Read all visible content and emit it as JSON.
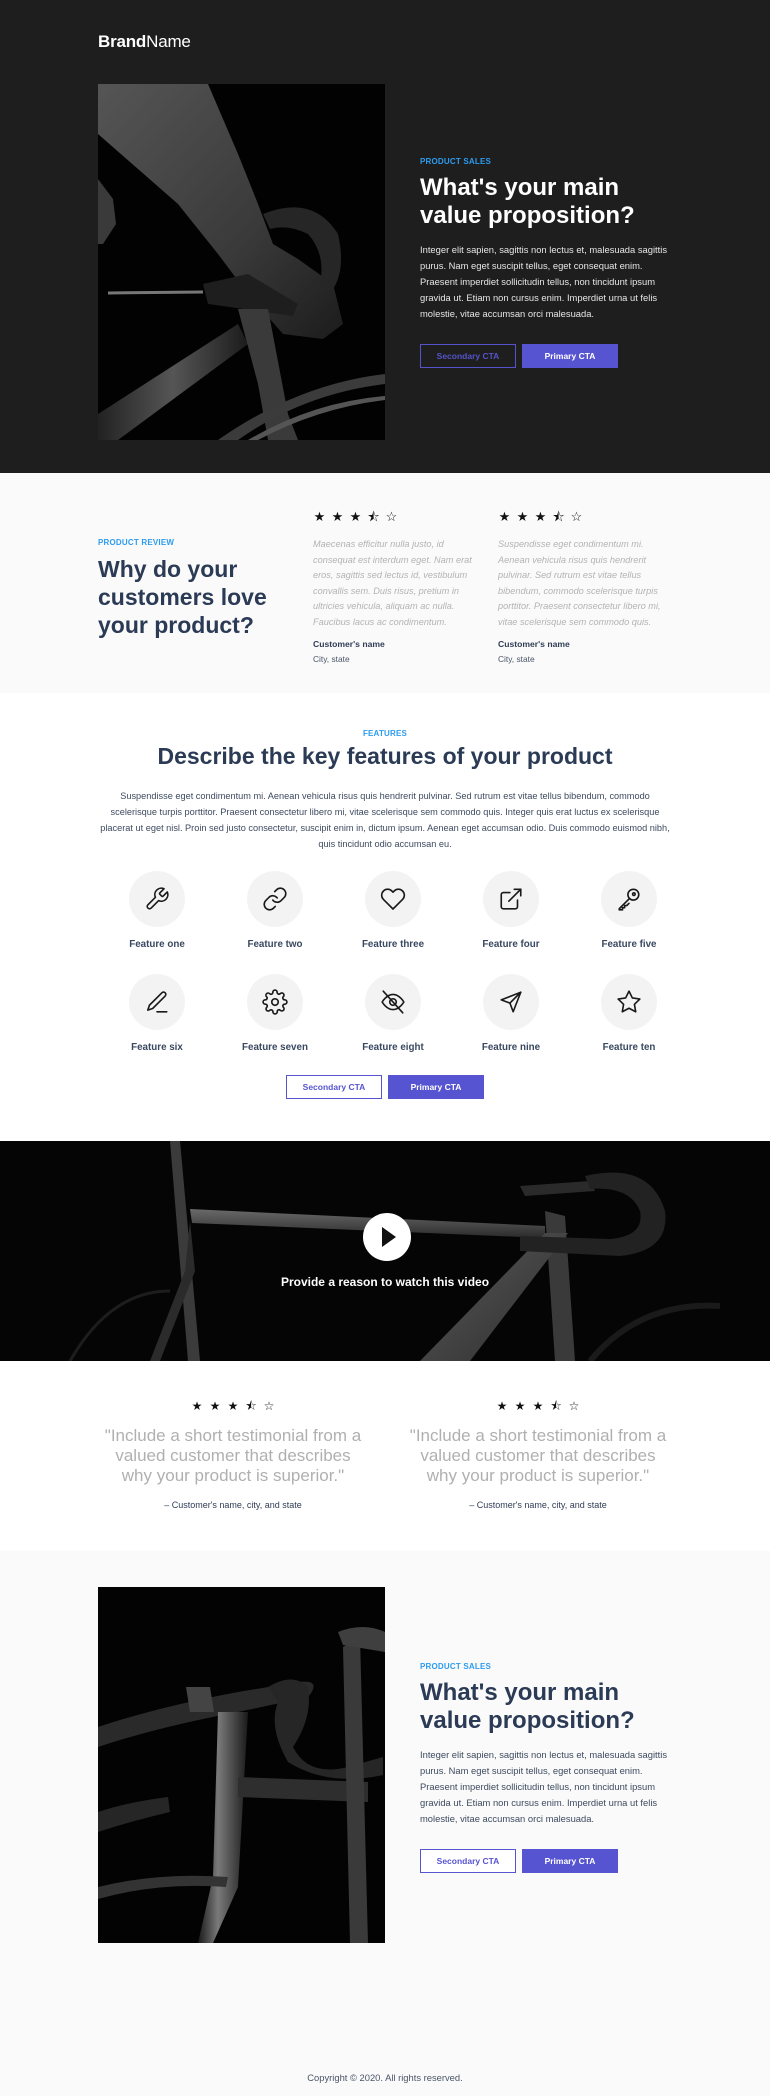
{
  "brand": {
    "bold": "Brand",
    "regular": "Name"
  },
  "hero": {
    "eyebrow": "PRODUCT SALES",
    "title": "What's your main value proposition?",
    "body": "Integer elit sapien, sagittis non lectus et, malesuada sagittis purus. Nam eget suscipit tellus, eget consequat enim. Praesent imperdiet sollicitudin tellus, non tincidunt ipsum gravida ut. Etiam non cursus enim. Imperdiet urna ut felis molestie, vitae accumsan orci malesuada.",
    "secondary_cta": "Secondary CTA",
    "primary_cta": "Primary CTA",
    "image_alt": "cyclist-arm-on-handlebar-photo"
  },
  "review": {
    "eyebrow": "PRODUCT REVIEW",
    "title": "Why do your customers love your product?",
    "cards": [
      {
        "rating": 3.5,
        "stars": [
          "★",
          "★",
          "★",
          "⯪",
          "☆"
        ],
        "text": "Maecenas efficitur nulla justo, id consequat est interdum eget. Nam erat eros, sagittis sed lectus id, vestibulum convallis sem. Duis risus, pretium in ultricies vehicula, aliquam ac nulla. Faucibus lacus ac condimentum.",
        "name": "Customer's name",
        "location": "City, state"
      },
      {
        "rating": 3.5,
        "stars": [
          "★",
          "★",
          "★",
          "⯪",
          "☆"
        ],
        "text": "Suspendisse eget condimentum mi. Aenean vehicula risus quis hendrerit pulvinar. Sed rutrum est vitae tellus bibendum, commodo scelerisque turpis porttitor. Praesent consectetur libero mi, vitae scelerisque sem commodo quis.",
        "name": "Customer's name",
        "location": "City, state"
      }
    ]
  },
  "features": {
    "eyebrow": "FEATURES",
    "title": "Describe the key features of your product",
    "description": "Suspendisse eget condimentum mi. Aenean vehicula risus quis hendrerit pulvinar. Sed rutrum est vitae tellus bibendum, commodo scelerisque turpis porttitor. Praesent consectetur libero mi, vitae scelerisque sem commodo quis. Integer quis erat luctus ex scelerisque placerat ut eget nisl. Proin sed justo consectetur, suscipit enim in, dictum ipsum. Aenean eget accumsan odio. Duis commodo euismod nibh, quis tincidunt odio accumsan eu.",
    "items": [
      {
        "label": "Feature one",
        "icon": "wrench-icon"
      },
      {
        "label": "Feature two",
        "icon": "link-icon"
      },
      {
        "label": "Feature three",
        "icon": "heart-icon"
      },
      {
        "label": "Feature four",
        "icon": "external-link-icon"
      },
      {
        "label": "Feature five",
        "icon": "key-icon"
      },
      {
        "label": "Feature six",
        "icon": "pen-icon"
      },
      {
        "label": "Feature seven",
        "icon": "gear-icon"
      },
      {
        "label": "Feature eight",
        "icon": "eye-off-icon"
      },
      {
        "label": "Feature nine",
        "icon": "send-icon"
      },
      {
        "label": "Feature ten",
        "icon": "star-icon"
      }
    ],
    "secondary_cta": "Secondary CTA",
    "primary_cta": "Primary CTA"
  },
  "video": {
    "caption": "Provide a reason to watch this video",
    "play_icon": "play-icon"
  },
  "testimonials": [
    {
      "rating": 3.5,
      "stars": [
        "★",
        "★",
        "★",
        "⯪",
        "☆"
      ],
      "quote": "\"Include a short testimonial from a valued customer that describes why your product is superior.\"",
      "author": "– Customer's name, city, and state"
    },
    {
      "rating": 3.5,
      "stars": [
        "★",
        "★",
        "★",
        "⯪",
        "☆"
      ],
      "quote": "\"Include a short testimonial from a valued customer that describes why your product is superior.\"",
      "author": "– Customer's name, city, and state"
    }
  ],
  "sales2": {
    "eyebrow": "PRODUCT SALES",
    "title": "What's your main value proposition?",
    "body": "Integer elit sapien, sagittis non lectus et, malesuada sagittis purus. Nam eget suscipit tellus, eget consequat enim. Praesent imperdiet sollicitudin tellus, non tincidunt ipsum gravida ut. Etiam non cursus enim. Imperdiet urna ut felis molestie, vitae accumsan orci malesuada.",
    "secondary_cta": "Secondary CTA",
    "primary_cta": "Primary CTA",
    "image_alt": "bicycle-handlebar-photo"
  },
  "footer": {
    "copyright": "Copyright © 2020. All rights reserved."
  },
  "colors": {
    "accent": "#5754d1",
    "eyebrow": "#2d9cf0",
    "heading": "#2b3a55",
    "hero_bg": "#1e1e1e",
    "light_bg": "#fafafa",
    "muted_text": "#b3b3b3"
  }
}
